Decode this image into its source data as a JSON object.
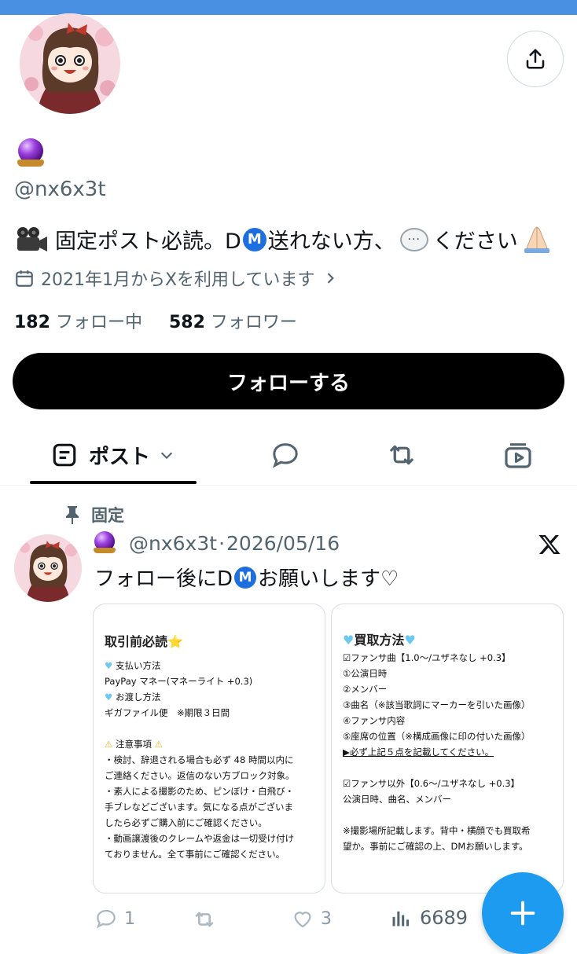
{
  "profile": {
    "handle": "@nx6x3t",
    "bio": {
      "prefix": "固定ポスト必読。D",
      "m_badge": "M",
      "middle": "送れない方、",
      "bubble_dots": "···",
      "suffix": "ください"
    },
    "joined": "2021年1月からXを利用しています",
    "following_count": "182",
    "following_label": "フォロー中",
    "followers_count": "582",
    "followers_label": "フォロワー",
    "follow_button": "フォローする"
  },
  "tabs": {
    "posts_label": "ポスト"
  },
  "post": {
    "pinned_label": "固定",
    "handle": "@nx6x3t",
    "separator": "·",
    "date": "2026/05/16",
    "text_prefix": "フォロー後にD",
    "m_badge": "M",
    "text_suffix": "お願いします♡",
    "card1": {
      "title": "取引前必読⭐",
      "lines": [
        "支払い方法",
        "PayPay マネー(マネーライト +0.3)",
        "お渡し方法",
        "ギガファイル便　※期限３日間",
        "",
        "注意事項",
        "・検討、辞退される場合も必ず 48 時間以内に",
        "ご連絡ください。返信のない方ブロック対象。",
        "・素人による撮影のため、ピンぼけ・白飛び・",
        "手ブレなどございます。気になる点がございま",
        "したら必ずご購入前にご確認ください。",
        "・動画譲渡後のクレームや返金は一切受け付け",
        "ておりません。全て事前にご確認ください。"
      ]
    },
    "card2": {
      "title": "買取方法",
      "lines": [
        "☑ファンサ曲【1.0〜/ユザネなし +0.3】",
        "①公演日時",
        "②メンバー",
        "③曲名（※該当歌詞にマーカーを引いた画像）",
        "④ファンサ内容",
        "⑤座席の位置（※構成画像に印の付いた画像）",
        "▶必ず上記５点を記載してください。",
        "",
        "☑ファンサ以外【0.6〜/ユザネなし +0.3】",
        "公演日時、曲名、メンバー",
        "",
        "※撮影場所記載します。背中・横顔でも買取希",
        "望か。事前にご確認の上、DMお願いします。"
      ]
    },
    "actions": {
      "replies": "1",
      "retweets": "",
      "likes": "3",
      "views": "6689"
    }
  },
  "colors": {
    "accent": "#1d9bf0",
    "top_bar": "#4a90e2",
    "secondary_text": "#536471",
    "m_badge": "#1d6fe0"
  }
}
